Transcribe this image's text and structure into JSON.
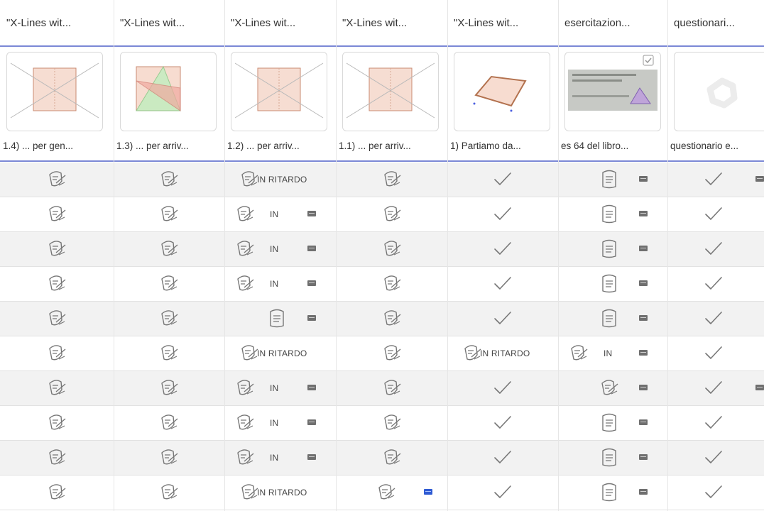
{
  "columns": [
    {
      "header": "\"X-Lines wit...",
      "caption": "1.4) ... per gen...",
      "thumb": "x-lines-square-icon"
    },
    {
      "header": "\"X-Lines wit...",
      "caption": "1.3) ... per arriv...",
      "thumb": "x-lines-triangles-icon"
    },
    {
      "header": "\"X-Lines wit...",
      "caption": "1.2) ... per arriv...",
      "thumb": "x-lines-square-icon"
    },
    {
      "header": "\"X-Lines wit...",
      "caption": "1.1) ... per arriv...",
      "thumb": "x-lines-square-icon"
    },
    {
      "header": "\"X-Lines wit...",
      "caption": "1) Partiamo da...",
      "thumb": "quadrilateral-icon"
    },
    {
      "header": "esercitazion...",
      "caption": "es 64 del libro...",
      "thumb": "photo-icon"
    },
    {
      "header": "questionari...",
      "caption": "questionario e...",
      "thumb": "placeholder-ring-icon"
    }
  ],
  "status": {
    "late_full": "IN RITARDO",
    "late_short": "IN"
  },
  "colors": {
    "rule": "#7b88d6",
    "icon": "#777777",
    "comment_unread": "#2f5bd3",
    "comment": "#6f6f6f"
  },
  "rows": [
    [
      [
        "sub"
      ],
      [
        "sub"
      ],
      [
        "sub",
        "late_full"
      ],
      [
        "sub"
      ],
      [
        "check"
      ],
      [
        "doc",
        "msg"
      ],
      [
        "check",
        "msg"
      ]
    ],
    [
      [
        "sub"
      ],
      [
        "sub"
      ],
      [
        "sub",
        "late_short",
        "msg"
      ],
      [
        "sub"
      ],
      [
        "check"
      ],
      [
        "doc",
        "msg"
      ],
      [
        "check"
      ]
    ],
    [
      [
        "sub"
      ],
      [
        "sub"
      ],
      [
        "sub",
        "late_short",
        "msg"
      ],
      [
        "sub"
      ],
      [
        "check"
      ],
      [
        "doc",
        "msg"
      ],
      [
        "check"
      ]
    ],
    [
      [
        "sub"
      ],
      [
        "sub"
      ],
      [
        "sub",
        "late_short",
        "msg"
      ],
      [
        "sub"
      ],
      [
        "check"
      ],
      [
        "doc",
        "msg"
      ],
      [
        "check"
      ]
    ],
    [
      [
        "sub"
      ],
      [
        "sub"
      ],
      [
        "doc",
        "msg"
      ],
      [
        "sub"
      ],
      [
        "check"
      ],
      [
        "doc",
        "msg"
      ],
      [
        "check"
      ]
    ],
    [
      [
        "sub"
      ],
      [
        "sub"
      ],
      [
        "sub",
        "late_full"
      ],
      [
        "sub"
      ],
      [
        "sub",
        "late_full"
      ],
      [
        "sub",
        "late_short",
        "msg"
      ],
      [
        "check"
      ]
    ],
    [
      [
        "sub"
      ],
      [
        "sub"
      ],
      [
        "sub",
        "late_short",
        "msg"
      ],
      [
        "sub"
      ],
      [
        "check"
      ],
      [
        "sub",
        "msg"
      ],
      [
        "check",
        "msg"
      ]
    ],
    [
      [
        "sub"
      ],
      [
        "sub"
      ],
      [
        "sub",
        "late_short",
        "msg"
      ],
      [
        "sub"
      ],
      [
        "check"
      ],
      [
        "doc",
        "msg"
      ],
      [
        "check"
      ]
    ],
    [
      [
        "sub"
      ],
      [
        "sub"
      ],
      [
        "sub",
        "late_short",
        "msg"
      ],
      [
        "sub"
      ],
      [
        "check"
      ],
      [
        "doc",
        "msg"
      ],
      [
        "check"
      ]
    ],
    [
      [
        "sub"
      ],
      [
        "sub"
      ],
      [
        "sub",
        "late_full"
      ],
      [
        "sub",
        "msg_blue"
      ],
      [
        "check"
      ],
      [
        "doc",
        "msg"
      ],
      [
        "check"
      ]
    ]
  ]
}
